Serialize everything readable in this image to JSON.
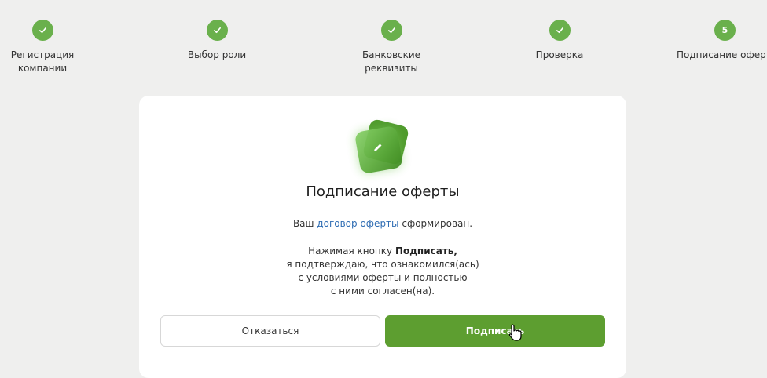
{
  "stepper": {
    "steps": [
      {
        "label": "Регистрация\nкомпании",
        "status": "done"
      },
      {
        "label": "Выбор роли",
        "status": "done"
      },
      {
        "label": "Банковские\nреквизиты",
        "status": "done"
      },
      {
        "label": "Проверка",
        "status": "done"
      },
      {
        "label": "Подписание оферты",
        "status": "current",
        "number": "5"
      }
    ]
  },
  "card": {
    "title": "Подписание оферты",
    "offer_prefix": "Ваш ",
    "offer_link": "договор оферты",
    "offer_suffix": " сформирован.",
    "para_prefix": "Нажимая кнопку ",
    "para_bold": "Подписать,",
    "para_line2": "я подтверждаю, что ознакомился(ась)",
    "para_line3": "с условиями оферты и полностью",
    "para_line4": "с ними согласен(на).",
    "decline_label": "Отказаться",
    "sign_label": "Подписать"
  },
  "colors": {
    "accent": "#6ab04c",
    "button": "#5d9e30",
    "link": "#2f6db3"
  }
}
